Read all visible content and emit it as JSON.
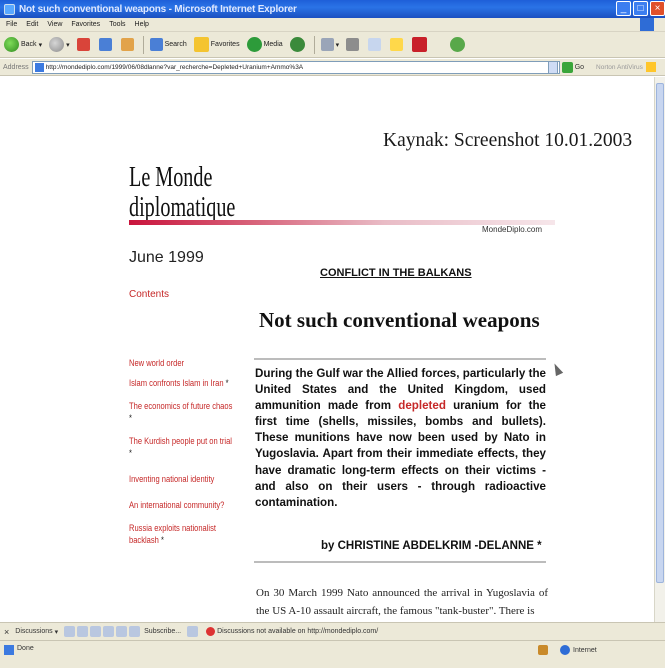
{
  "window": {
    "title": "Not such conventional weapons - Microsoft Internet Explorer",
    "controls": [
      "_",
      "□",
      "×"
    ]
  },
  "menu": [
    "File",
    "Edit",
    "View",
    "Favorites",
    "Tools",
    "Help"
  ],
  "toolbar": {
    "back": "Back",
    "search": "Search",
    "favorites": "Favorites",
    "media": "Media"
  },
  "address": {
    "label": "Address",
    "url": "http://mondediplo.com/1999/06/08dlanne?var_recherche=Depleted+Uranium+Ammo%3A",
    "go": "Go",
    "norton": "Norton AntiVirus"
  },
  "page": {
    "source_note": "Kaynak: Screenshot 10.01.2003",
    "masthead_line1": "Le Monde",
    "masthead_line2": "diplomatique",
    "site_name": "MondeDiplo.com",
    "issue_date": "June 1999",
    "section": "CONFLICT IN THE BALKANS",
    "contents": "Contents",
    "title": "Not such conventional weapons",
    "nav": [
      {
        "text": "New world order",
        "star": ""
      },
      {
        "text": "Islam confronts Islam in Iran",
        "star": "*"
      },
      {
        "text": "The economics of future chaos",
        "star": "*"
      },
      {
        "text": "The Kurdish people put on trial",
        "star": "*"
      },
      {
        "text": "Inventing national identity",
        "star": ""
      },
      {
        "text": "An international community?",
        "star": ""
      },
      {
        "text": "Russia exploits nationalist backlash",
        "star": "*"
      }
    ],
    "lead": {
      "before": "During the Gulf war the Allied forces, particularly the United States and the United Kingdom, used ammunition made from ",
      "highlight": "depleted",
      "after": " uranium for the first time (shells, missiles, bombs and bullets). These munitions have now been used by Nato in Yugoslavia. Apart from their immediate effects, they have dramatic long-term effects on their victims - and also on their users - through radioactive contamination."
    },
    "byline": "by CHRISTINE ABDELKRIM -DELANNE *",
    "body": "On 30 March 1999 Nato announced the arrival in Yugoslavia of the US A-10 assault aircraft, the famous \"tank-buster\". There is"
  },
  "discussions": {
    "label": "Discussions",
    "subscribe": "Subscribe...",
    "message": "Discussions not available on http://mondediplo.com/"
  },
  "status": {
    "text": "Done",
    "zone": "Internet"
  }
}
